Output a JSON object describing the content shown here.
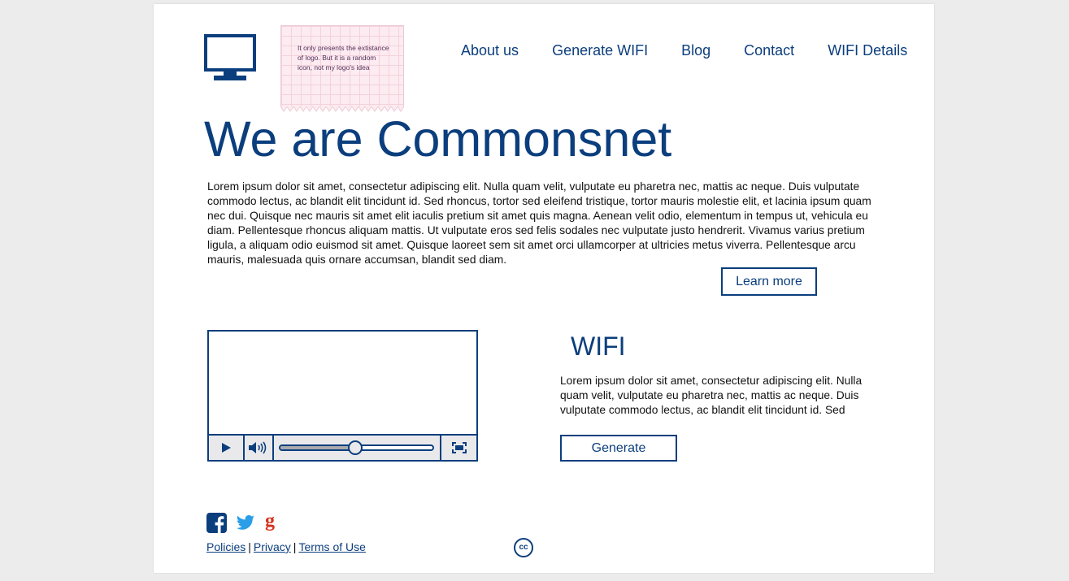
{
  "header": {
    "logo_icon": "monitor-icon",
    "sticky_note": "It only presents the extistance of logo. But it is a random icon, not my logo's idea",
    "nav": [
      {
        "label": "About us"
      },
      {
        "label": "Generate WIFI"
      },
      {
        "label": "Blog"
      },
      {
        "label": "Contact"
      },
      {
        "label": "WIFI Details"
      }
    ]
  },
  "hero": {
    "title": "We are Commonsnet",
    "text": "Lorem ipsum dolor sit amet, consectetur adipiscing elit. Nulla quam velit, vulputate eu pharetra nec, mattis ac neque. Duis vulputate commodo lectus, ac blandit elit tincidunt id. Sed rhoncus, tortor sed eleifend tristique, tortor mauris molestie elit, et lacinia ipsum quam nec dui. Quisque nec mauris sit amet elit iaculis pretium sit amet quis magna. Aenean velit odio, elementum in tempus ut, vehicula eu diam. Pellentesque rhoncus aliquam mattis. Ut vulputate eros sed felis sodales nec vulputate justo hendrerit. Vivamus varius pretium ligula, a aliquam odio euismod sit amet. Quisque laoreet sem sit amet orci ullamcorper at ultricies metus viverra. Pellentesque arcu mauris, malesuada quis ornare accumsan, blandit sed diam.",
    "button_label": "Learn more"
  },
  "video": {
    "play_icon": "play-icon",
    "volume_icon": "volume-icon",
    "fullscreen_icon": "fullscreen-icon",
    "progress": 0.49
  },
  "wifi": {
    "title": "WIFI",
    "text": "Lorem ipsum dolor sit amet, consectetur adipiscing elit. Nulla quam velit, vulputate eu pharetra nec, mattis ac neque. Duis vulputate commodo lectus, ac blandit elit tincidunt id. Sed",
    "button_label": "Generate"
  },
  "footer": {
    "social": [
      "facebook-icon",
      "twitter-icon",
      "google-plus-icon"
    ],
    "links": [
      {
        "label": "Policies"
      },
      {
        "label": "Privacy"
      },
      {
        "label": "Terms of Use"
      }
    ],
    "cc_badge": "cc"
  },
  "colors": {
    "brand": "#0b3e7d",
    "page_background": "#ececec",
    "facebook": "#0b3e7d",
    "twitter": "#2a9ee6",
    "google": "#d6321f"
  }
}
